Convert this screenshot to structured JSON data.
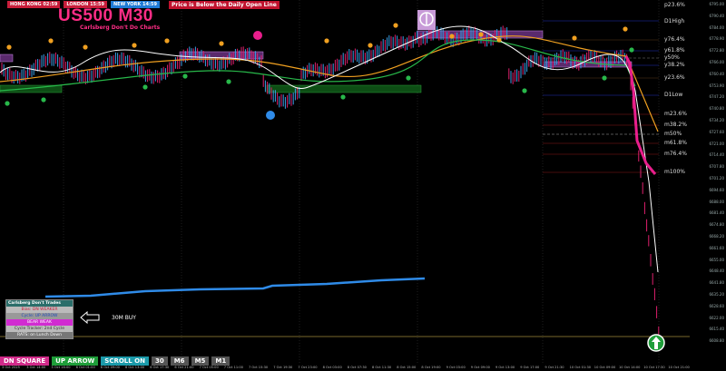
{
  "sessions": [
    {
      "label": "HONG KONG 02:59",
      "color": "#c81d3a"
    },
    {
      "label": "LONDON 15:59",
      "color": "#c81d3a"
    },
    {
      "label": "NEW YORK 14:59",
      "color": "#1e7bd6"
    }
  ],
  "warning_text": "Price is Below the Daily Open Line",
  "symbol_title": "US500 M30",
  "subtitle": "Carlsberg Don't Do Charts",
  "fib_levels": [
    "p23.6%",
    "D1High",
    "y76.4%",
    "y61.8%",
    "y50%",
    "y38.2%",
    "y23.6%",
    "D1Low",
    "m23.6%",
    "m38.2%",
    "m50%",
    "m61.8%",
    "m76.4%",
    "m100%"
  ],
  "price_axis": [
    "6795.00",
    "6790.40",
    "6784.00",
    "6778.90",
    "6772.80",
    "6766.00",
    "6760.40",
    "6753.90",
    "6747.20",
    "6740.80",
    "6734.20",
    "6727.60",
    "6721.00",
    "6714.40",
    "6707.80",
    "6701.20",
    "6694.60",
    "6688.00",
    "6681.40",
    "6674.80",
    "6668.20",
    "6661.60",
    "6655.00",
    "6648.40",
    "6641.80",
    "6635.20",
    "6628.60",
    "6622.00",
    "6615.40",
    "6608.80"
  ],
  "panel": {
    "title": "Carlsberg Don't Trades",
    "rows": [
      "Bias: DN WEAKER",
      "Cycle: UP ARROW",
      "BEAR WEAK",
      "Cycle Tracker: 2nd Cycle",
      "RATS: on Lunch Down"
    ]
  },
  "signal_label": "30M BUY",
  "buttons": [
    {
      "label": "DN SQUARE",
      "color": "#d12b8a"
    },
    {
      "label": "UP ARROW",
      "color": "#1f9e3a"
    },
    {
      "label": "SCROLL ON",
      "color": "#1b9aaa"
    },
    {
      "label": "30",
      "color": "#555555"
    },
    {
      "label": "M6",
      "color": "#555555"
    },
    {
      "label": "M5",
      "color": "#555555"
    },
    {
      "label": "M1",
      "color": "#555555"
    }
  ],
  "time_axis": [
    "3 Oct 2025",
    "3 Oct 14:00",
    "3 Oct 16:00",
    "6 Oct 01:00",
    "6 Oct 09:00",
    "6 Oct 13:00",
    "6 Oct 17:30",
    "6 Oct 21:00",
    "7 Oct 05:00",
    "7 Oct 11:00",
    "7 Oct 15:30",
    "7 Oct 19:30",
    "7 Oct 23:00",
    "8 Oct 03:00",
    "8 Oct 07:30",
    "8 Oct 11:30",
    "8 Oct 15:00",
    "8 Oct 19:00",
    "9 Oct 03:00",
    "9 Oct 09:00",
    "9 Oct 13:00",
    "9 Oct 17:00",
    "9 Oct 21:30",
    "10 Oct 01:30",
    "10 Oct 09:00",
    "10 Oct 14:00",
    "10 Oct 17:30",
    "10 Oct 21:00"
  ]
}
